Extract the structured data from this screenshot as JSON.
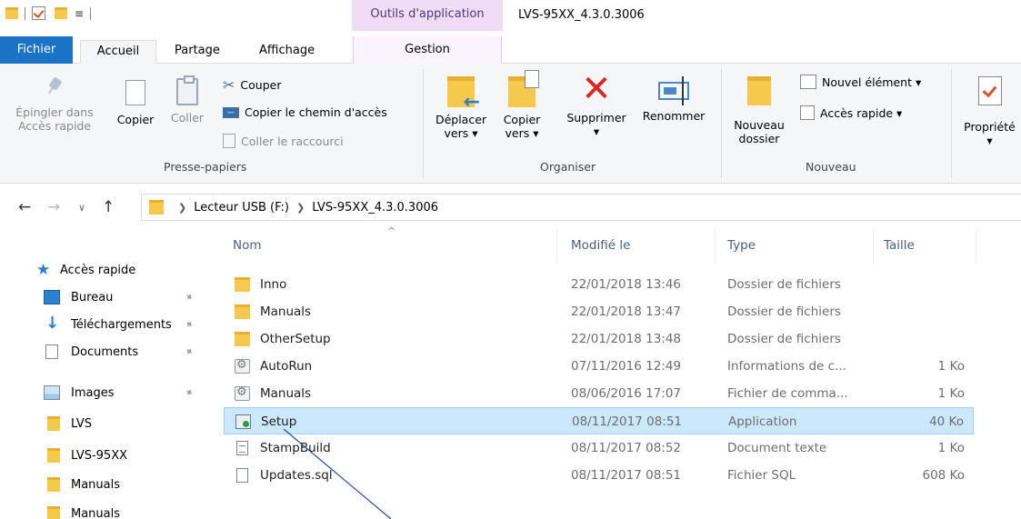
{
  "titlebar": {
    "context_header": "Outils d'application",
    "window_title": "LVS-95XX_4.3.0.3006"
  },
  "tabs": {
    "file": "Fichier",
    "home": "Accueil",
    "share": "Partage",
    "view": "Affichage",
    "manage": "Gestion"
  },
  "ribbon": {
    "clipboard": {
      "pin_label_1": "Épingler dans",
      "pin_label_2": "Accès rapide",
      "copy": "Copier",
      "paste": "Coller",
      "cut": "Couper",
      "copy_path": "Copier le chemin d'accès",
      "paste_shortcut": "Coller le raccourci",
      "group_label": "Presse-papiers"
    },
    "organize": {
      "move_1": "Déplacer",
      "move_2": "vers ▾",
      "copy_1": "Copier",
      "copy_2": "vers ▾",
      "delete": "Supprimer",
      "delete_arrow": "▾",
      "rename": "Renommer",
      "group_label": "Organiser"
    },
    "new": {
      "new_folder_1": "Nouveau",
      "new_folder_2": "dossier",
      "new_item": "Nouvel élément ▾",
      "easy_access": "Accès rapide ▾",
      "group_label": "Nouveau"
    },
    "open": {
      "properties": "Propriété",
      "properties_arrow": "▾"
    }
  },
  "address": {
    "crumbs": [
      "Lecteur USB (F:)",
      "LVS-95XX_4.3.0.3006"
    ]
  },
  "navpane": {
    "quick_access": "Accès rapide",
    "items": [
      {
        "label": "Bureau",
        "icon": "desktop-icon",
        "pinned": true
      },
      {
        "label": "Téléchargements",
        "icon": "download-icon",
        "pinned": true
      },
      {
        "label": "Documents",
        "icon": "documents-icon",
        "pinned": true
      },
      {
        "label": "Images",
        "icon": "images-icon",
        "pinned": true
      },
      {
        "label": "LVS",
        "icon": "folder-icon",
        "pinned": false
      },
      {
        "label": "LVS-95XX",
        "icon": "folder-icon",
        "pinned": false
      },
      {
        "label": "Manuals",
        "icon": "folder-icon",
        "pinned": false
      },
      {
        "label": "Manuals",
        "icon": "folder-icon",
        "pinned": false
      }
    ]
  },
  "filelist": {
    "columns": {
      "name": "Nom",
      "modified": "Modifié le",
      "type": "Type",
      "size": "Taille"
    },
    "sort_caret": "^",
    "rows": [
      {
        "name": "Inno",
        "date": "22/01/2018 13:46",
        "type": "Dossier de fichiers",
        "size": "",
        "icon": "folder-icon"
      },
      {
        "name": "Manuals",
        "date": "22/01/2018 13:47",
        "type": "Dossier de fichiers",
        "size": "",
        "icon": "folder-icon"
      },
      {
        "name": "OtherSetup",
        "date": "22/01/2018 13:48",
        "type": "Dossier de fichiers",
        "size": "",
        "icon": "folder-icon"
      },
      {
        "name": "AutoRun",
        "date": "07/11/2016 12:49",
        "type": "Informations de c...",
        "size": "1 Ko",
        "icon": "settings-file-icon"
      },
      {
        "name": "Manuals",
        "date": "08/06/2016 17:07",
        "type": "Fichier de comma...",
        "size": "1 Ko",
        "icon": "command-file-icon"
      },
      {
        "name": "Setup",
        "date": "08/11/2017 08:51",
        "type": "Application",
        "size": "40 Ko",
        "icon": "application-icon",
        "selected": true
      },
      {
        "name": "StampBuild",
        "date": "08/11/2017 08:52",
        "type": "Document texte",
        "size": "1 Ko",
        "icon": "text-file-icon"
      },
      {
        "name": "Updates.sql",
        "date": "08/11/2017 08:51",
        "type": "Fichier SQL",
        "size": "608 Ko",
        "icon": "sql-file-icon"
      }
    ]
  },
  "colors": {
    "accent": "#1a73c4",
    "selection": "#cce8ff",
    "context_tab": "#f1dcf8",
    "folder": "#f6c84c",
    "delete_red": "#e02424"
  }
}
